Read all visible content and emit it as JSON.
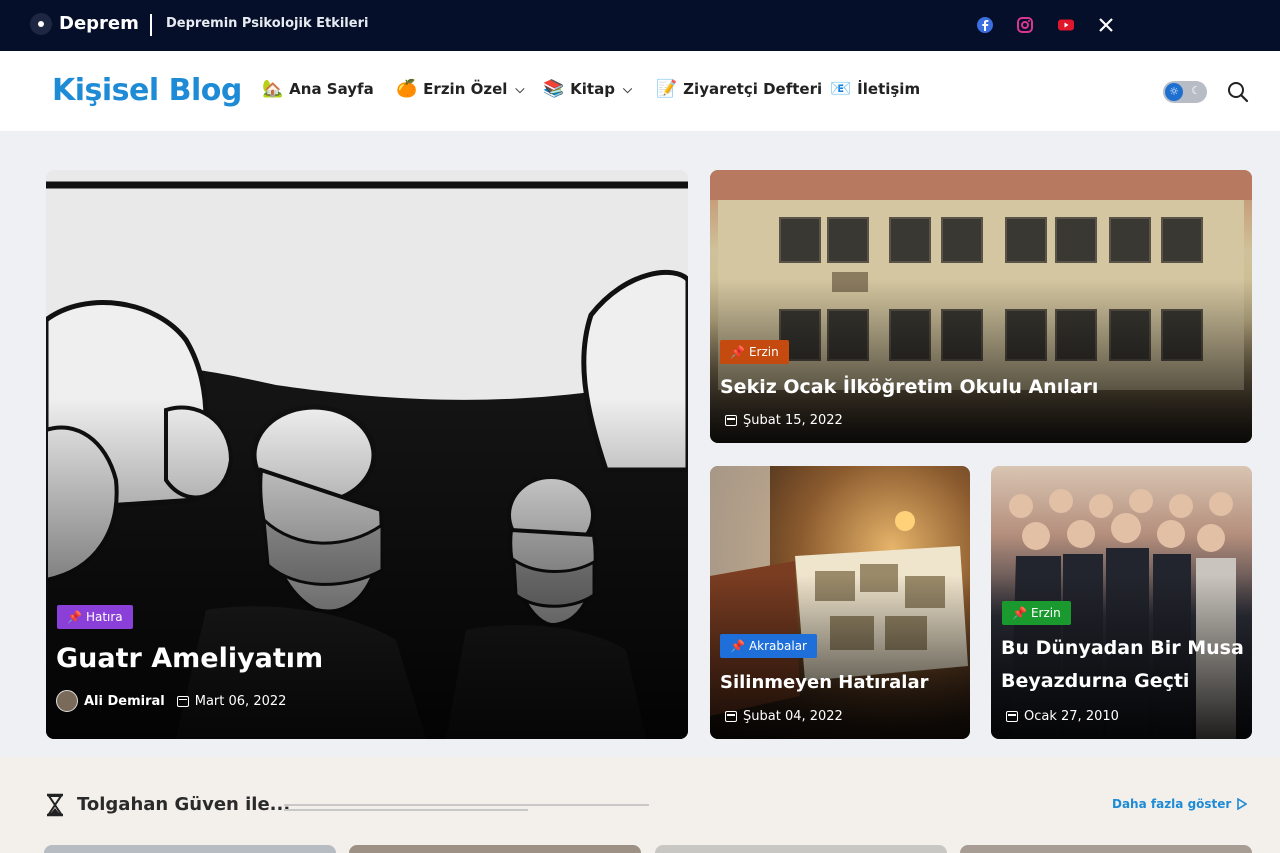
{
  "topbar": {
    "ticker_title": "Deprem",
    "ticker_text": "Depremin Psikolojik Etkileri",
    "social_icons": [
      "facebook-icon",
      "instagram-icon",
      "youtube-icon",
      "x-icon"
    ]
  },
  "header": {
    "logo": "Kişisel Blog",
    "nav": [
      {
        "emoji": "🏡",
        "label": "Ana Sayfa",
        "has_dropdown": false
      },
      {
        "emoji": "🍊",
        "label": "Erzin Özel",
        "has_dropdown": true
      },
      {
        "emoji": "📚",
        "label": "Kitap",
        "has_dropdown": true
      },
      {
        "emoji": "📝",
        "label": "Ziyaretçi Defteri",
        "has_dropdown": false
      },
      {
        "emoji": "📧",
        "label": "İletişim",
        "has_dropdown": false
      }
    ]
  },
  "featured": {
    "main": {
      "category": "Hatıra",
      "category_color": "#8b3fd9",
      "title": "Guatr Ameliyatım",
      "author": "Ali Demiral",
      "date": "Mart 06, 2022"
    },
    "side": [
      {
        "category": "Erzin",
        "category_color": "#c44a0f",
        "title": "Sekiz Ocak İlköğretim Okulu Anıları",
        "date": "Şubat 15, 2022"
      },
      {
        "category": "Akrabalar",
        "category_color": "#1e6fd9",
        "title": "Silinmeyen Hatıralar",
        "date": "Şubat 04, 2022"
      },
      {
        "category": "Erzin",
        "category_color": "#1a9a2e",
        "title": "Bu Dünyadan Bir Musa Beyazdurna Geçti",
        "date": "Ocak 27, 2010"
      }
    ]
  },
  "section": {
    "title": "Tolgahan Güven ile...",
    "more_label": "Daha fazla göster"
  },
  "colors": {
    "topbar_bg": "#050f2a",
    "brand": "#1e8bd6"
  }
}
